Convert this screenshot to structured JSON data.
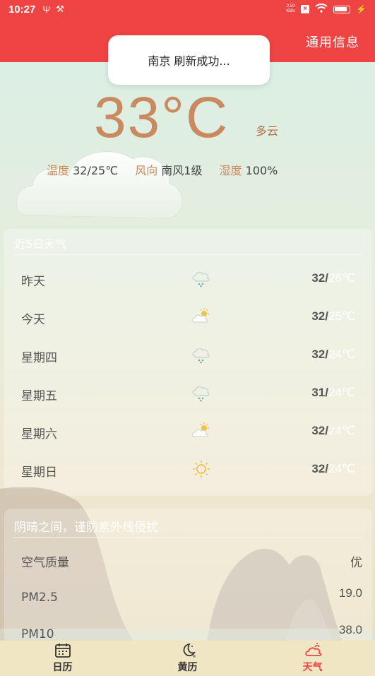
{
  "status_bar": {
    "time": "10:27",
    "icons": [
      "usb-icon",
      "tools-icon"
    ],
    "net_speed_value": "2.50",
    "net_speed_unit": "KB/s",
    "right_icons": [
      "sim-x-icon",
      "wifi-icon",
      "battery-icon",
      "charging-icon"
    ]
  },
  "header": {
    "general_info_link": "通用信息",
    "brand_color": "#ee4444"
  },
  "toast": {
    "message": "南京 刷新成功..."
  },
  "current": {
    "temperature": "33°C",
    "condition": "多云",
    "temp_label": "温度",
    "temp_range": "32/25℃",
    "wind_label": "风向",
    "wind_value": "南风1级",
    "humidity_label": "湿度",
    "humidity_value": "100%"
  },
  "forecast": {
    "title": "近5日天气",
    "days": [
      {
        "day": "昨天",
        "icon": "rain-icon",
        "high": "32/",
        "low": "26℃"
      },
      {
        "day": "今天",
        "icon": "partly-sunny-icon",
        "high": "32/",
        "low": "25℃"
      },
      {
        "day": "星期四",
        "icon": "rain-icon",
        "high": "32/",
        "low": "24℃"
      },
      {
        "day": "星期五",
        "icon": "rain-icon",
        "high": "31/",
        "low": "24℃"
      },
      {
        "day": "星期六",
        "icon": "partly-sunny-icon",
        "high": "32/",
        "low": "24℃"
      },
      {
        "day": "星期日",
        "icon": "sun-icon",
        "high": "32/",
        "low": "24℃"
      }
    ]
  },
  "air": {
    "tip": "阴晴之间，谨防紫外线侵扰",
    "rows": [
      {
        "name": "空气质量",
        "value": "优"
      },
      {
        "name": "PM2.5",
        "value": "19.0"
      },
      {
        "name": "PM10",
        "value": "38.0"
      }
    ]
  },
  "nav": {
    "items": [
      {
        "label": "日历",
        "icon": "calendar-icon"
      },
      {
        "label": "黄历",
        "icon": "moon-icon"
      },
      {
        "label": "天气",
        "icon": "weather-icon"
      }
    ],
    "active_color": "#ee4444"
  }
}
